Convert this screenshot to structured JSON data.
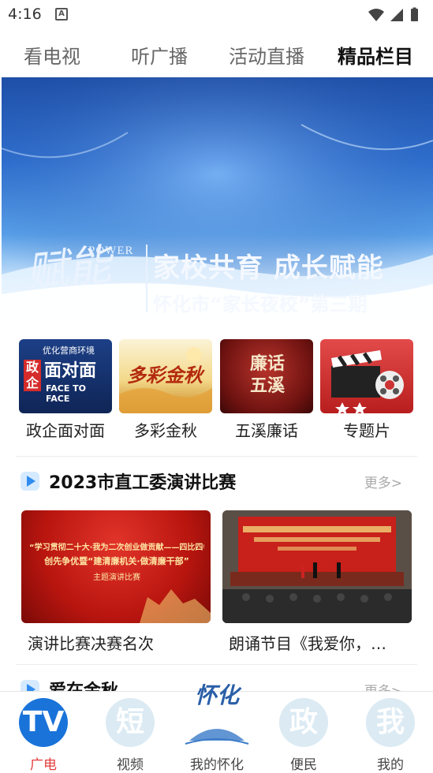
{
  "status_bar": {
    "time": "4:16",
    "notification": "A"
  },
  "tabs": [
    {
      "label": "看电视"
    },
    {
      "label": "听广播"
    },
    {
      "label": "活动直播"
    },
    {
      "label": "精品栏目"
    }
  ],
  "active_tab_index": 3,
  "banner": {
    "calligraphy": "赋能",
    "english": "POWER",
    "title": "家校共育 成长赋能",
    "subtitle": "怀化市“家长夜校”第三期"
  },
  "categories": [
    {
      "label": "政企面对面",
      "thumb_title": "面对面",
      "thumb_top": "优化营商环境",
      "thumb_sub": "FACE TO FACE",
      "thumb_tag": "政企"
    },
    {
      "label": "多彩金秋",
      "thumb_title": "多彩金秋"
    },
    {
      "label": "五溪廉话",
      "thumb_title": "廉话五溪"
    },
    {
      "label": "专题片"
    }
  ],
  "section1": {
    "title": "2023市直工委演讲比赛",
    "more": "更多>",
    "videos": [
      {
        "caption": "演讲比赛决赛名次",
        "thumb_line1": "“学习贯彻二十大·我为二次创业做贡献——四比四争”",
        "thumb_line2": "创先争优暨“建清廉机关·做清廉干部”",
        "thumb_line3": "主题演讲比赛"
      },
      {
        "caption": "朗诵节目《我爱你，…"
      }
    ]
  },
  "section2": {
    "title": "爱在金秋",
    "more": "更多>"
  },
  "bottom_nav": [
    {
      "label": "广电",
      "glyph": "TV"
    },
    {
      "label": "视频",
      "glyph": "短"
    },
    {
      "label": "我的怀化",
      "glyph": "怀化"
    },
    {
      "label": "便民",
      "glyph": "政"
    },
    {
      "label": "我的",
      "glyph": "我"
    }
  ],
  "colors": {
    "accent_blue": "#1a73d9",
    "active_nav_label": "#e53b3b",
    "more_text": "#aaaaaa"
  }
}
